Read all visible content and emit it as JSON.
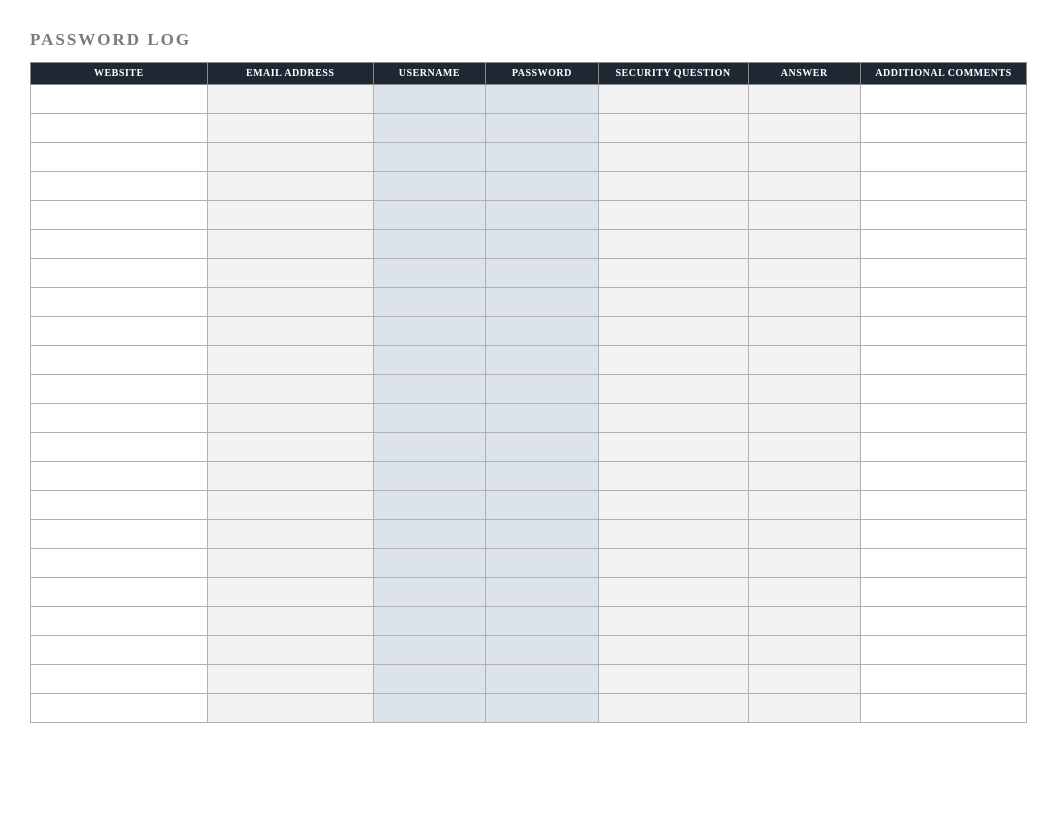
{
  "title": "PASSWORD LOG",
  "columns": [
    "WEBSITE",
    "EMAIL ADDRESS",
    "USERNAME",
    "PASSWORD",
    "SECURITY QUESTION",
    "ANSWER",
    "ADDITIONAL COMMENTS"
  ],
  "rows": [
    {
      "website": "",
      "email": "",
      "username": "",
      "password": "",
      "security": "",
      "answer": "",
      "comments": ""
    },
    {
      "website": "",
      "email": "",
      "username": "",
      "password": "",
      "security": "",
      "answer": "",
      "comments": ""
    },
    {
      "website": "",
      "email": "",
      "username": "",
      "password": "",
      "security": "",
      "answer": "",
      "comments": ""
    },
    {
      "website": "",
      "email": "",
      "username": "",
      "password": "",
      "security": "",
      "answer": "",
      "comments": ""
    },
    {
      "website": "",
      "email": "",
      "username": "",
      "password": "",
      "security": "",
      "answer": "",
      "comments": ""
    },
    {
      "website": "",
      "email": "",
      "username": "",
      "password": "",
      "security": "",
      "answer": "",
      "comments": ""
    },
    {
      "website": "",
      "email": "",
      "username": "",
      "password": "",
      "security": "",
      "answer": "",
      "comments": ""
    },
    {
      "website": "",
      "email": "",
      "username": "",
      "password": "",
      "security": "",
      "answer": "",
      "comments": ""
    },
    {
      "website": "",
      "email": "",
      "username": "",
      "password": "",
      "security": "",
      "answer": "",
      "comments": ""
    },
    {
      "website": "",
      "email": "",
      "username": "",
      "password": "",
      "security": "",
      "answer": "",
      "comments": ""
    },
    {
      "website": "",
      "email": "",
      "username": "",
      "password": "",
      "security": "",
      "answer": "",
      "comments": ""
    },
    {
      "website": "",
      "email": "",
      "username": "",
      "password": "",
      "security": "",
      "answer": "",
      "comments": ""
    },
    {
      "website": "",
      "email": "",
      "username": "",
      "password": "",
      "security": "",
      "answer": "",
      "comments": ""
    },
    {
      "website": "",
      "email": "",
      "username": "",
      "password": "",
      "security": "",
      "answer": "",
      "comments": ""
    },
    {
      "website": "",
      "email": "",
      "username": "",
      "password": "",
      "security": "",
      "answer": "",
      "comments": ""
    },
    {
      "website": "",
      "email": "",
      "username": "",
      "password": "",
      "security": "",
      "answer": "",
      "comments": ""
    },
    {
      "website": "",
      "email": "",
      "username": "",
      "password": "",
      "security": "",
      "answer": "",
      "comments": ""
    },
    {
      "website": "",
      "email": "",
      "username": "",
      "password": "",
      "security": "",
      "answer": "",
      "comments": ""
    },
    {
      "website": "",
      "email": "",
      "username": "",
      "password": "",
      "security": "",
      "answer": "",
      "comments": ""
    },
    {
      "website": "",
      "email": "",
      "username": "",
      "password": "",
      "security": "",
      "answer": "",
      "comments": ""
    },
    {
      "website": "",
      "email": "",
      "username": "",
      "password": "",
      "security": "",
      "answer": "",
      "comments": ""
    },
    {
      "website": "",
      "email": "",
      "username": "",
      "password": "",
      "security": "",
      "answer": "",
      "comments": ""
    }
  ],
  "column_classes": [
    "col-website",
    "col-email",
    "col-username",
    "col-password",
    "col-security",
    "col-answer",
    "col-comments"
  ]
}
